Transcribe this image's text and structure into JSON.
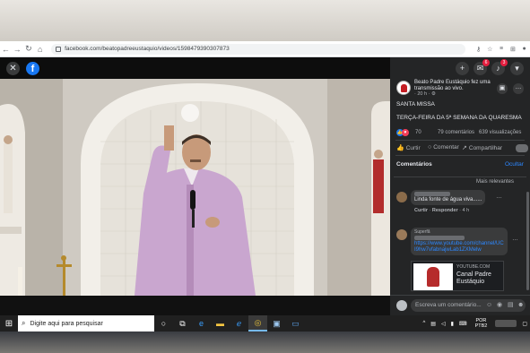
{
  "browser": {
    "url": "facebook.com/beatopadreeustaquio/videos/1598479390307873",
    "nav_icons": [
      "back-icon",
      "forward-icon",
      "reload-icon",
      "home-icon"
    ],
    "right_icons": [
      "key-icon",
      "star-icon",
      "playlist-icon",
      "extension-icon",
      "profile-icon"
    ]
  },
  "viewer": {
    "close_label": "✕",
    "logo_label": "f"
  },
  "header": {
    "notifications": {
      "messenger_badge": "6",
      "bell_badge": "3"
    }
  },
  "post": {
    "author_line": "Beato Padre Eustáquio fez uma transmissão ao vivo.",
    "meta": "· 20 h · ⚙",
    "title": "SANTA MISSA",
    "subtitle": "TERÇA-FEIRA DA 5ª SEMANA DA QUARESMA",
    "reactions_count": "70",
    "comments_count": "79 comentários",
    "views_count": "639 visualizações"
  },
  "actions": {
    "like": "Curtir",
    "comment": "Comentar",
    "share": "Compartilhar"
  },
  "comments": {
    "title": "Comentários",
    "hide": "Ocultar",
    "sort": "Mais relevantes",
    "items": [
      {
        "text": "Linda fonte de água viva......",
        "reply_like": "Curtir",
        "reply": "Responder",
        "time": "4 h"
      },
      {
        "flag": "Superfã",
        "link": "https://www.youtube.com/channel/UCI9hw7vfabnajwLab1ZXMelw",
        "card_site": "YOUTUBE.COM",
        "card_title": "Canal Padre Eustáquio"
      }
    ],
    "write_placeholder": "Escreva um comentário..."
  },
  "taskbar": {
    "search_placeholder": "Digite aqui para pesquisar",
    "lang": "POR",
    "layout": "PTB2"
  },
  "colors": {
    "facebook_blue": "#1877f2",
    "panel_bg": "#242526",
    "link": "#2d88ff",
    "vestment": "#c9a6cf"
  }
}
